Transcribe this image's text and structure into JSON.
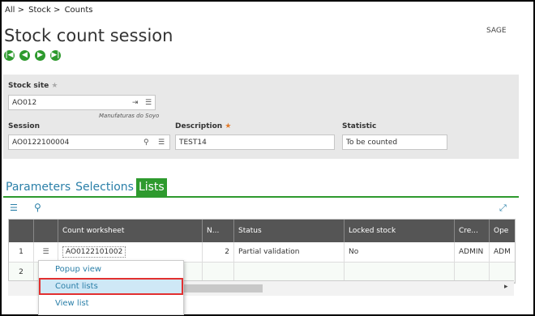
{
  "breadcrumb": [
    "All >",
    "Stock >",
    "Counts"
  ],
  "page_title": "Stock count session",
  "user": "SAGE",
  "fields": {
    "stock_site": {
      "label": "Stock site",
      "value": "AO012",
      "caption": "Manufaturas do Soyo"
    },
    "session": {
      "label": "Session",
      "value": "AO0122100004"
    },
    "description": {
      "label": "Description",
      "value": "TEST14"
    },
    "statistic": {
      "label": "Statistic",
      "value": "To be counted"
    }
  },
  "tabs": [
    "Parameters",
    "Selections",
    "Lists"
  ],
  "grid": {
    "headers": [
      "Count worksheet",
      "N...",
      "Status",
      "Locked stock",
      "Cre...",
      "Ope"
    ],
    "rows": [
      {
        "num": "1",
        "worksheet": "AO0122101002",
        "n": "2",
        "status": "Partial validation",
        "locked": "No",
        "created": "ADMIN",
        "op": "ADM"
      },
      {
        "num": "2",
        "worksheet": "",
        "n": "",
        "status": "",
        "locked": "",
        "created": "",
        "op": ""
      }
    ]
  },
  "context_menu": [
    "Popup view",
    "Count lists",
    "View list"
  ],
  "colors": {
    "green": "#2e9a2e",
    "link": "#2a7fa8",
    "highlight_outline": "#e23030"
  }
}
